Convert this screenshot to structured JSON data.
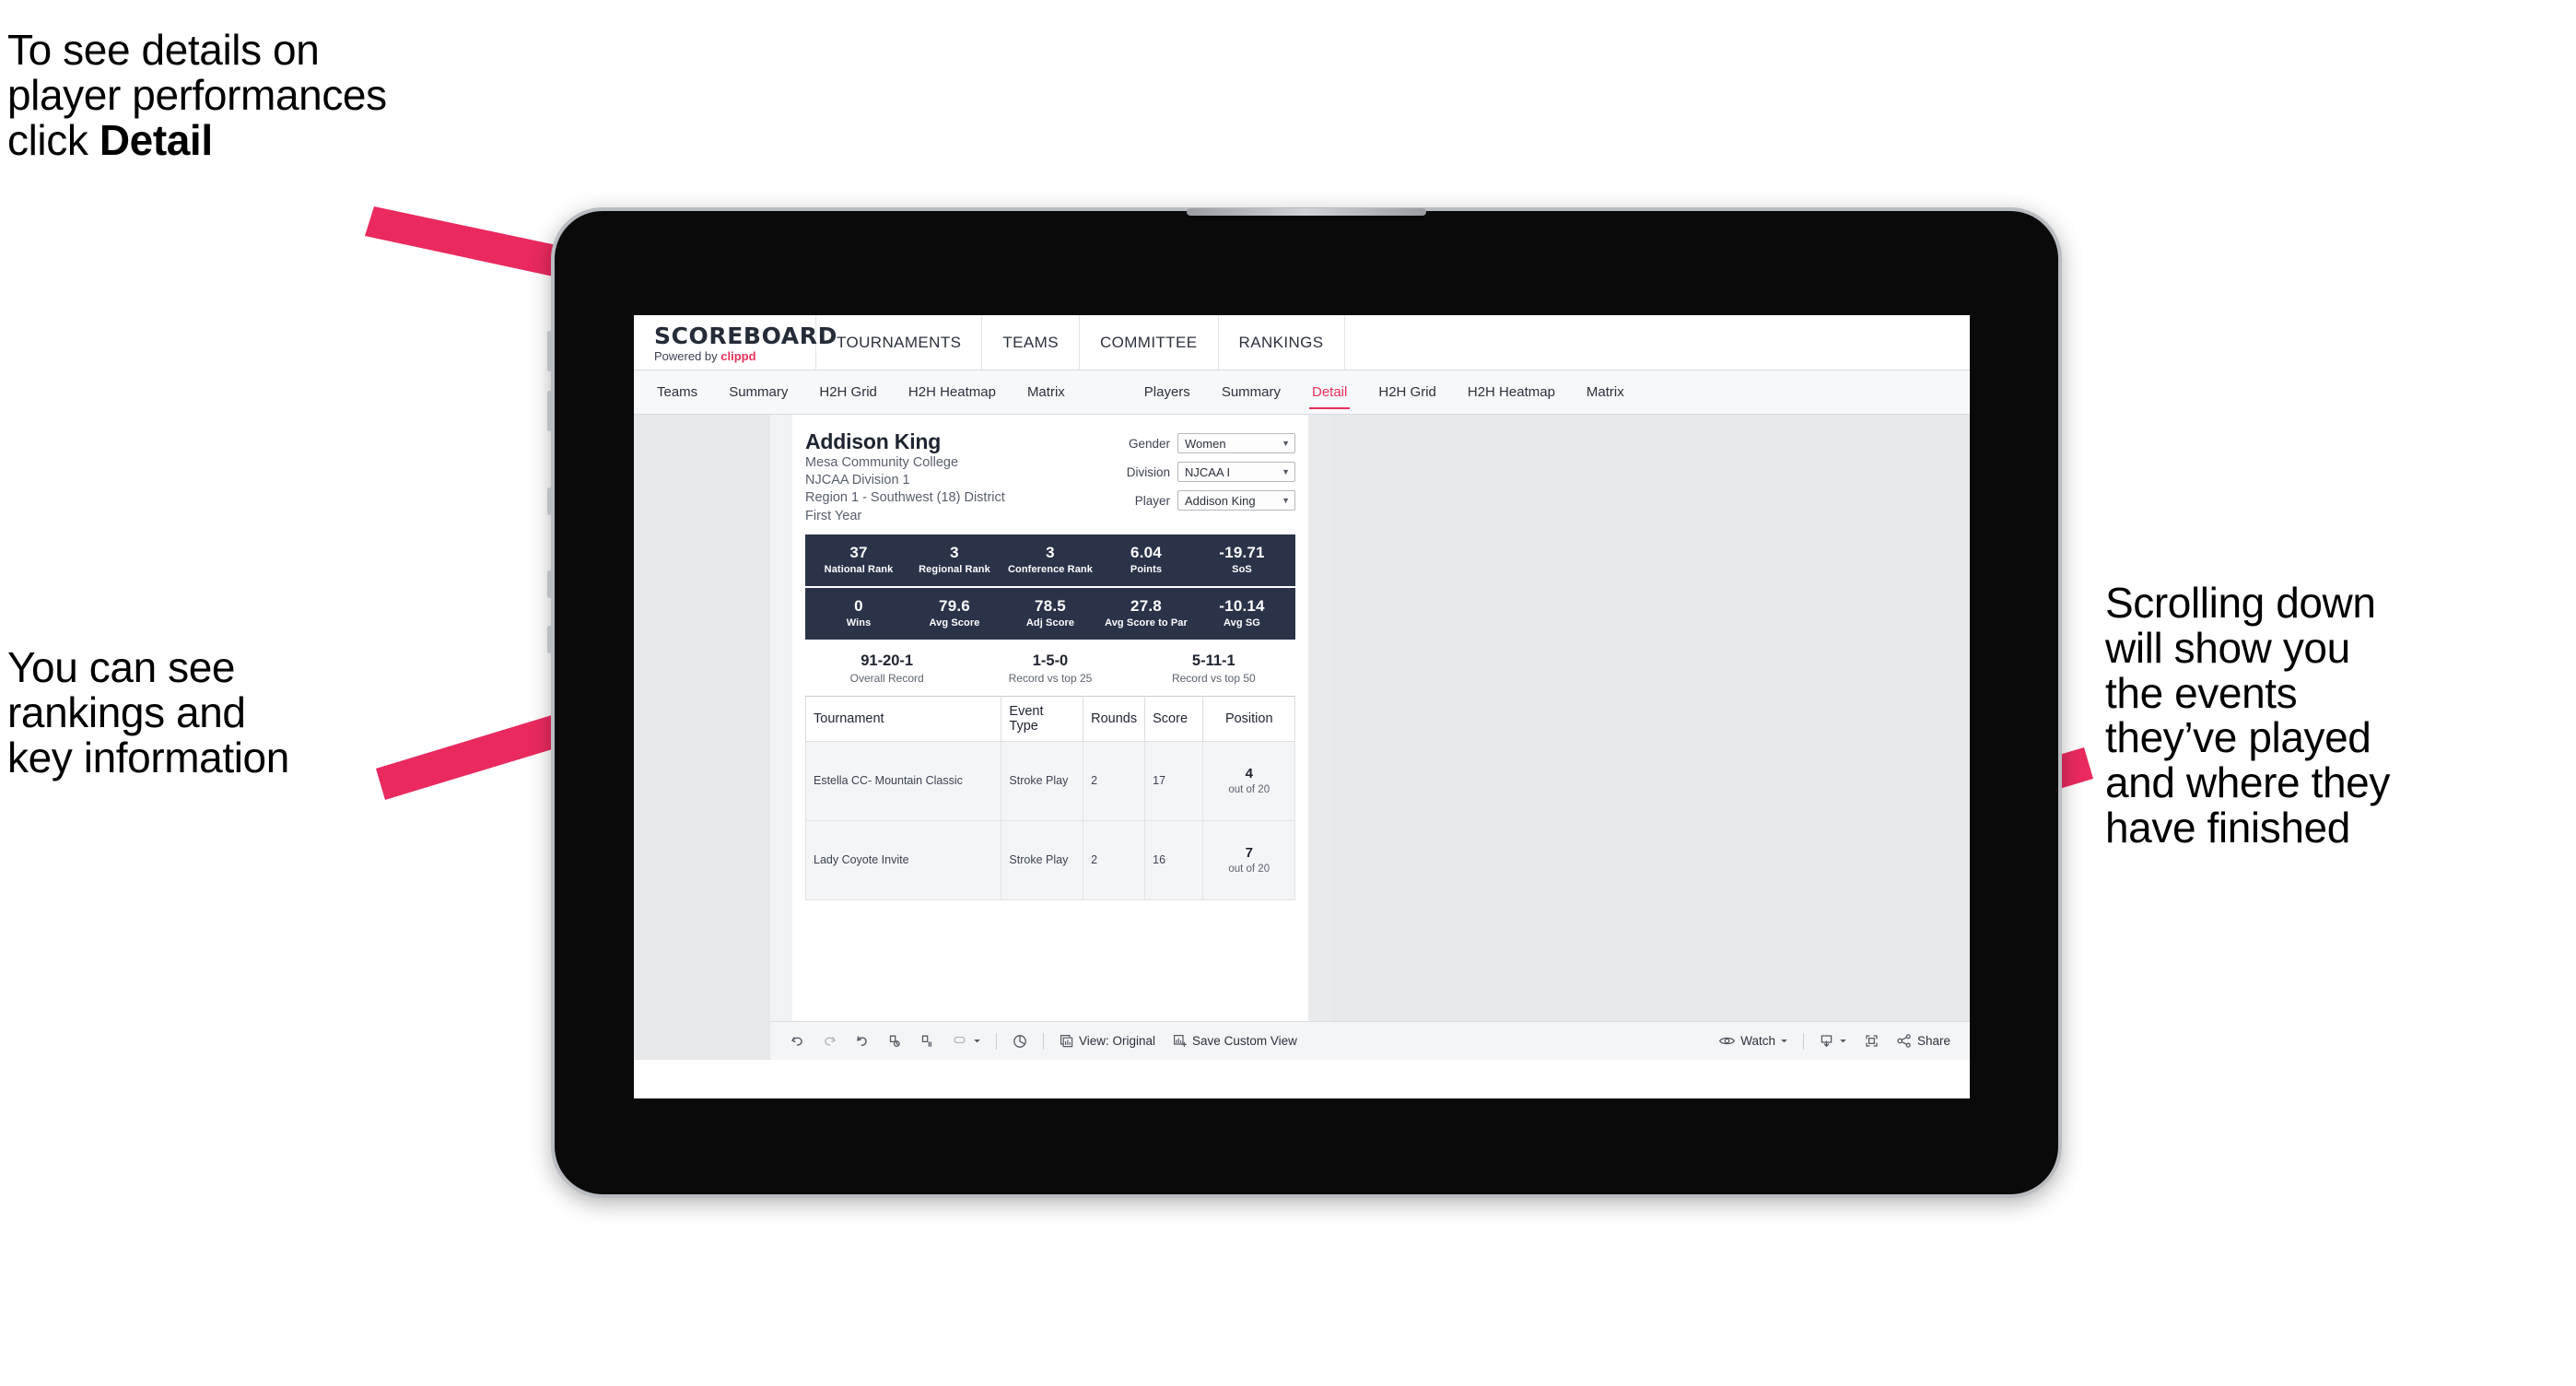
{
  "annotations": {
    "top": {
      "text_before": "To see details on\nplayer performances\nclick ",
      "bold": "Detail"
    },
    "left": {
      "text": "You can see\nrankings and\nkey information"
    },
    "right": {
      "text": "Scrolling down\nwill show you\nthe events\nthey’ve played\nand where they\nhave finished"
    }
  },
  "colors": {
    "accent_pink": "#e8305a",
    "band_navy": "#2b3349",
    "arrow_pink": "#ea2a5f"
  },
  "app": {
    "brand": {
      "title": "SCOREBOARD",
      "powered_prefix": "Powered by ",
      "powered_brand": "clippd"
    },
    "topnav": [
      {
        "label": "TOURNAMENTS"
      },
      {
        "label": "TEAMS"
      },
      {
        "label": "COMMITTEE"
      },
      {
        "label": "RANKINGS"
      }
    ],
    "subnav": {
      "group_teams": [
        {
          "label": "Teams",
          "active": false
        },
        {
          "label": "Summary",
          "active": false
        },
        {
          "label": "H2H Grid",
          "active": false
        },
        {
          "label": "H2H Heatmap",
          "active": false
        },
        {
          "label": "Matrix",
          "active": false
        }
      ],
      "group_players": [
        {
          "label": "Players",
          "active": false
        },
        {
          "label": "Summary",
          "active": false
        },
        {
          "label": "Detail",
          "active": true
        },
        {
          "label": "H2H Grid",
          "active": false
        },
        {
          "label": "H2H Heatmap",
          "active": false
        },
        {
          "label": "Matrix",
          "active": false
        }
      ]
    }
  },
  "player": {
    "name": "Addison King",
    "school": "Mesa Community College",
    "division": "NJCAA Division 1",
    "region": "Region 1 - Southwest (18) District",
    "year": "First Year"
  },
  "filters": [
    {
      "label": "Gender",
      "value": "Women"
    },
    {
      "label": "Division",
      "value": "NJCAA I"
    },
    {
      "label": "Player",
      "value": "Addison King"
    }
  ],
  "stat_bands": [
    [
      {
        "value": "37",
        "label": "National Rank"
      },
      {
        "value": "3",
        "label": "Regional Rank"
      },
      {
        "value": "3",
        "label": "Conference Rank"
      },
      {
        "value": "6.04",
        "label": "Points"
      },
      {
        "value": "-19.71",
        "label": "SoS"
      }
    ],
    [
      {
        "value": "0",
        "label": "Wins"
      },
      {
        "value": "79.6",
        "label": "Avg Score"
      },
      {
        "value": "78.5",
        "label": "Adj Score"
      },
      {
        "value": "27.8",
        "label": "Avg Score to Par"
      },
      {
        "value": "-10.14",
        "label": "Avg SG"
      }
    ]
  ],
  "records": [
    {
      "value": "91-20-1",
      "label": "Overall Record"
    },
    {
      "value": "1-5-0",
      "label": "Record vs top 25"
    },
    {
      "value": "5-11-1",
      "label": "Record vs top 50"
    }
  ],
  "events_table": {
    "headers": [
      "Tournament",
      "Event Type",
      "Rounds",
      "Score",
      "Position"
    ],
    "rows": [
      {
        "tournament": "Estella CC- Mountain Classic",
        "event_type": "Stroke Play",
        "rounds": "2",
        "score": "17",
        "position_value": "4",
        "position_label": "out of 20"
      },
      {
        "tournament": "Lady Coyote Invite",
        "event_type": "Stroke Play",
        "rounds": "2",
        "score": "16",
        "position_value": "7",
        "position_label": "out of 20"
      }
    ]
  },
  "toolbar": {
    "view_label": "View: Original",
    "save_view_label": "Save Custom View",
    "watch_label": "Watch",
    "share_label": "Share",
    "icons": [
      "undo-icon",
      "redo-icon",
      "revert-icon",
      "refresh-icon",
      "pause-icon",
      "subscribe-icon",
      "chevron-down-icon",
      "dashboard-icon",
      "view-original-icon",
      "save-custom-view-icon",
      "eye-icon",
      "download-icon",
      "fullscreen-icon",
      "share-icon"
    ]
  }
}
